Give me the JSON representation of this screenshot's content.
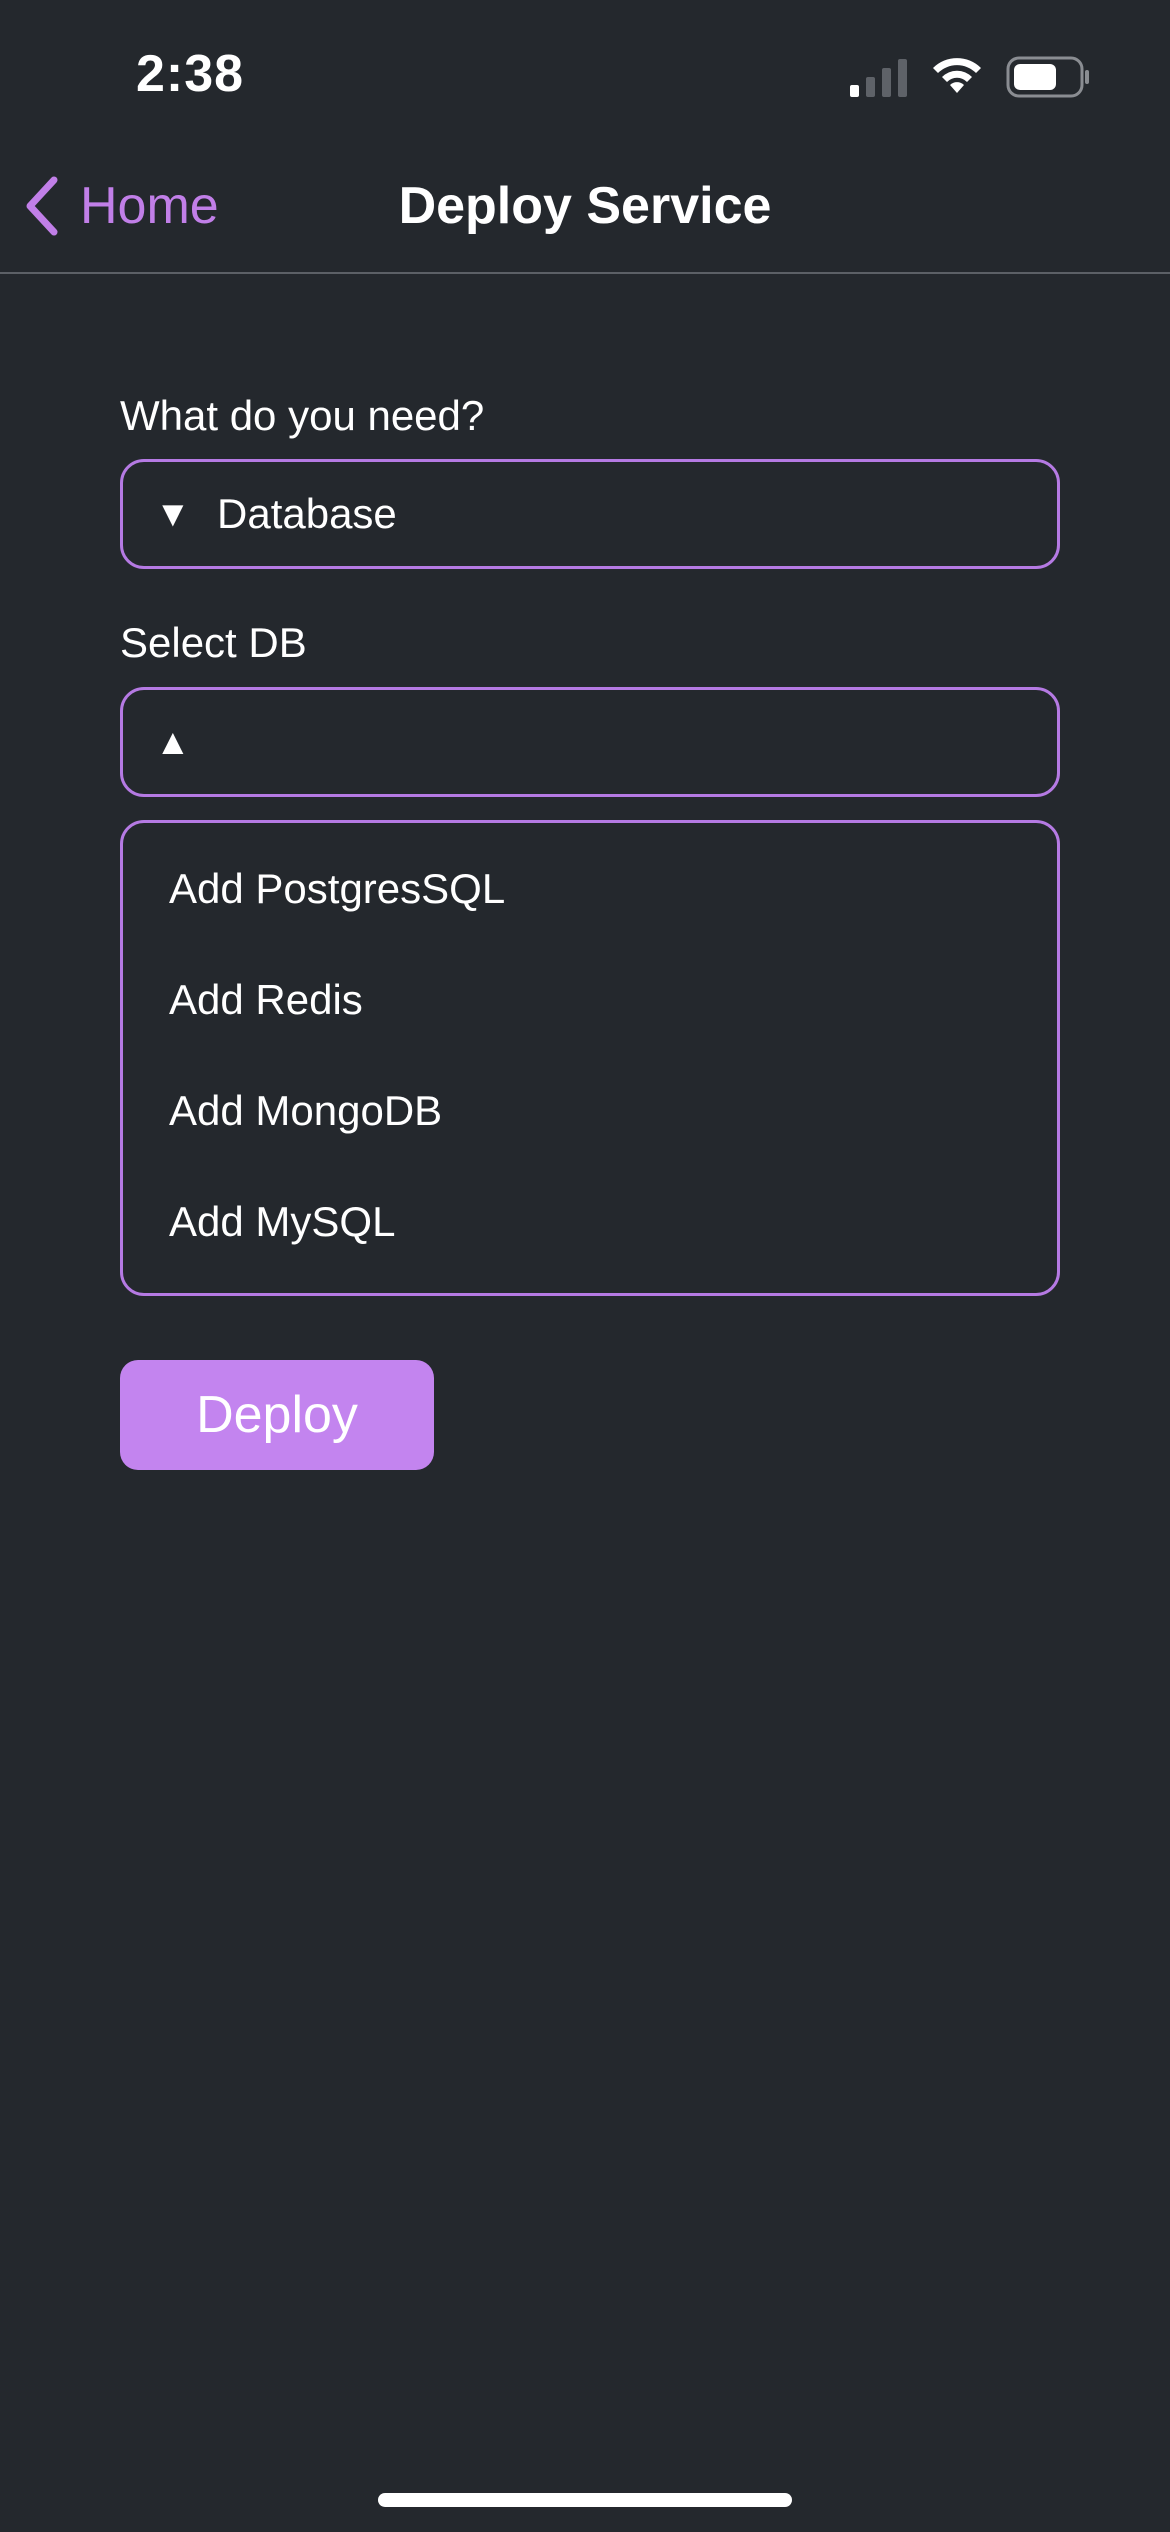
{
  "status_bar": {
    "time": "2:38",
    "signal_icon": "cellular-signal-icon",
    "wifi_icon": "wifi-icon",
    "battery_icon": "battery-icon"
  },
  "nav": {
    "back_label": "Home",
    "back_icon": "chevron-left-icon",
    "title": "Deploy Service"
  },
  "form": {
    "need_label": "What do you need?",
    "need_select": {
      "arrow": "▼",
      "value": "Database"
    },
    "db_label": "Select DB",
    "db_select": {
      "arrow": "▲",
      "value": ""
    },
    "db_options": [
      {
        "label": "Add PostgresSQL"
      },
      {
        "label": "Add Redis"
      },
      {
        "label": "Add MongoDB"
      },
      {
        "label": "Add MySQL"
      }
    ],
    "deploy_label": "Deploy"
  },
  "colors": {
    "background": "#24282d",
    "accent": "#c384ef",
    "border_accent": "#b57ae3",
    "text": "#ffffff"
  }
}
